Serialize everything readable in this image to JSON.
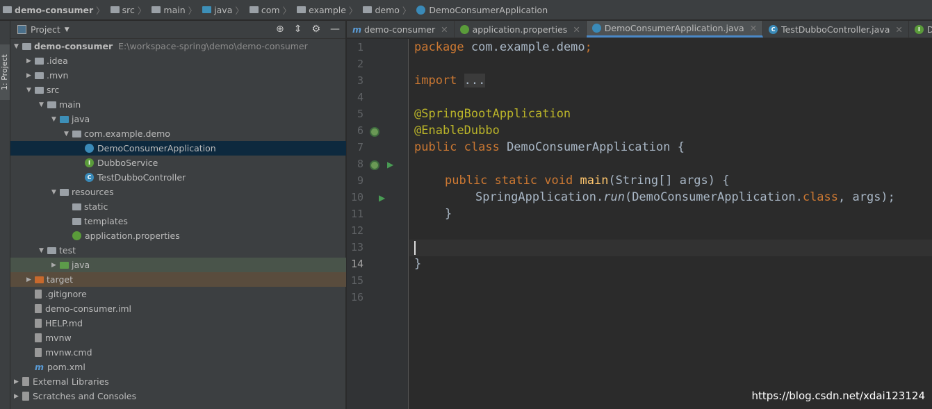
{
  "breadcrumb": [
    "demo-consumer",
    "src",
    "main",
    "java",
    "com",
    "example",
    "demo",
    "DemoConsumerApplication"
  ],
  "stripe_label": "1: Project",
  "panel": {
    "title": "Project",
    "tree": [
      {
        "label": "demo-consumer",
        "path": "E:\\workspace-spring\\demo\\demo-consumer",
        "depth": 0,
        "arrow": "▼",
        "icon": "module-folder",
        "bold": true
      },
      {
        "label": ".idea",
        "depth": 1,
        "arrow": "▶",
        "icon": "folder"
      },
      {
        "label": ".mvn",
        "depth": 1,
        "arrow": "▶",
        "icon": "folder"
      },
      {
        "label": "src",
        "depth": 1,
        "arrow": "▼",
        "icon": "folder"
      },
      {
        "label": "main",
        "depth": 2,
        "arrow": "▼",
        "icon": "folder"
      },
      {
        "label": "java",
        "depth": 3,
        "arrow": "▼",
        "icon": "source-folder"
      },
      {
        "label": "com.example.demo",
        "depth": 4,
        "arrow": "▼",
        "icon": "package"
      },
      {
        "label": "DemoConsumerApplication",
        "depth": 5,
        "arrow": "",
        "icon": "spring-class",
        "selected": true
      },
      {
        "label": "DubboService",
        "depth": 5,
        "arrow": "",
        "icon": "interface"
      },
      {
        "label": "TestDubboController",
        "depth": 5,
        "arrow": "",
        "icon": "class"
      },
      {
        "label": "resources",
        "depth": 3,
        "arrow": "▼",
        "icon": "resources-folder"
      },
      {
        "label": "static",
        "depth": 4,
        "arrow": "",
        "icon": "folder"
      },
      {
        "label": "templates",
        "depth": 4,
        "arrow": "",
        "icon": "folder"
      },
      {
        "label": "application.properties",
        "depth": 4,
        "arrow": "",
        "icon": "spring-properties"
      },
      {
        "label": "test",
        "depth": 2,
        "arrow": "▼",
        "icon": "folder"
      },
      {
        "label": "java",
        "depth": 3,
        "arrow": "▶",
        "icon": "test-folder",
        "test": true
      },
      {
        "label": "target",
        "depth": 1,
        "arrow": "▶",
        "icon": "excluded-folder",
        "target": true
      },
      {
        "label": ".gitignore",
        "depth": 1,
        "arrow": "",
        "icon": "file"
      },
      {
        "label": "demo-consumer.iml",
        "depth": 1,
        "arrow": "",
        "icon": "file"
      },
      {
        "label": "HELP.md",
        "depth": 1,
        "arrow": "",
        "icon": "markdown"
      },
      {
        "label": "mvnw",
        "depth": 1,
        "arrow": "",
        "icon": "file"
      },
      {
        "label": "mvnw.cmd",
        "depth": 1,
        "arrow": "",
        "icon": "file"
      },
      {
        "label": "pom.xml",
        "depth": 1,
        "arrow": "",
        "icon": "maven"
      },
      {
        "label": "External Libraries",
        "depth": 0,
        "arrow": "▶",
        "icon": "libraries"
      },
      {
        "label": "Scratches and Consoles",
        "depth": 0,
        "arrow": "▶",
        "icon": "scratches"
      }
    ]
  },
  "tabs": [
    {
      "label": "demo-consumer",
      "icon": "maven",
      "active": false
    },
    {
      "label": "application.properties",
      "icon": "spring-properties",
      "active": false
    },
    {
      "label": "DemoConsumerApplication.java",
      "icon": "spring-class",
      "active": true
    },
    {
      "label": "TestDubboController.java",
      "icon": "class",
      "active": false
    },
    {
      "label": "DubboSer",
      "icon": "interface",
      "active": false
    }
  ],
  "line_numbers": [
    "1",
    "2",
    "3",
    "4",
    "5",
    "6",
    "7",
    "8",
    "9",
    "10",
    "11",
    "12",
    "13",
    "14",
    "15",
    "16"
  ],
  "code": {
    "l1": {
      "kw": "package",
      "rest": " com.example.demo",
      "semi": ";"
    },
    "l3": {
      "kw": "import",
      "fold": "..."
    },
    "l7": "@SpringBootApplication",
    "l8": "@EnableDubbo",
    "l9": {
      "kw": "public class",
      "rest": " DemoConsumerApplication {"
    },
    "l11": {
      "kw": "public static void",
      "fn": "main",
      "rest": "(String[] args) {"
    },
    "l12": {
      "a": "SpringApplication.",
      "run": "run",
      "b": "(DemoConsumerApplication.",
      "kw": "class",
      ",": ", args);"
    },
    "l13": "}",
    "l15": "}"
  },
  "watermark": "https://blog.csdn.net/xdai123124"
}
